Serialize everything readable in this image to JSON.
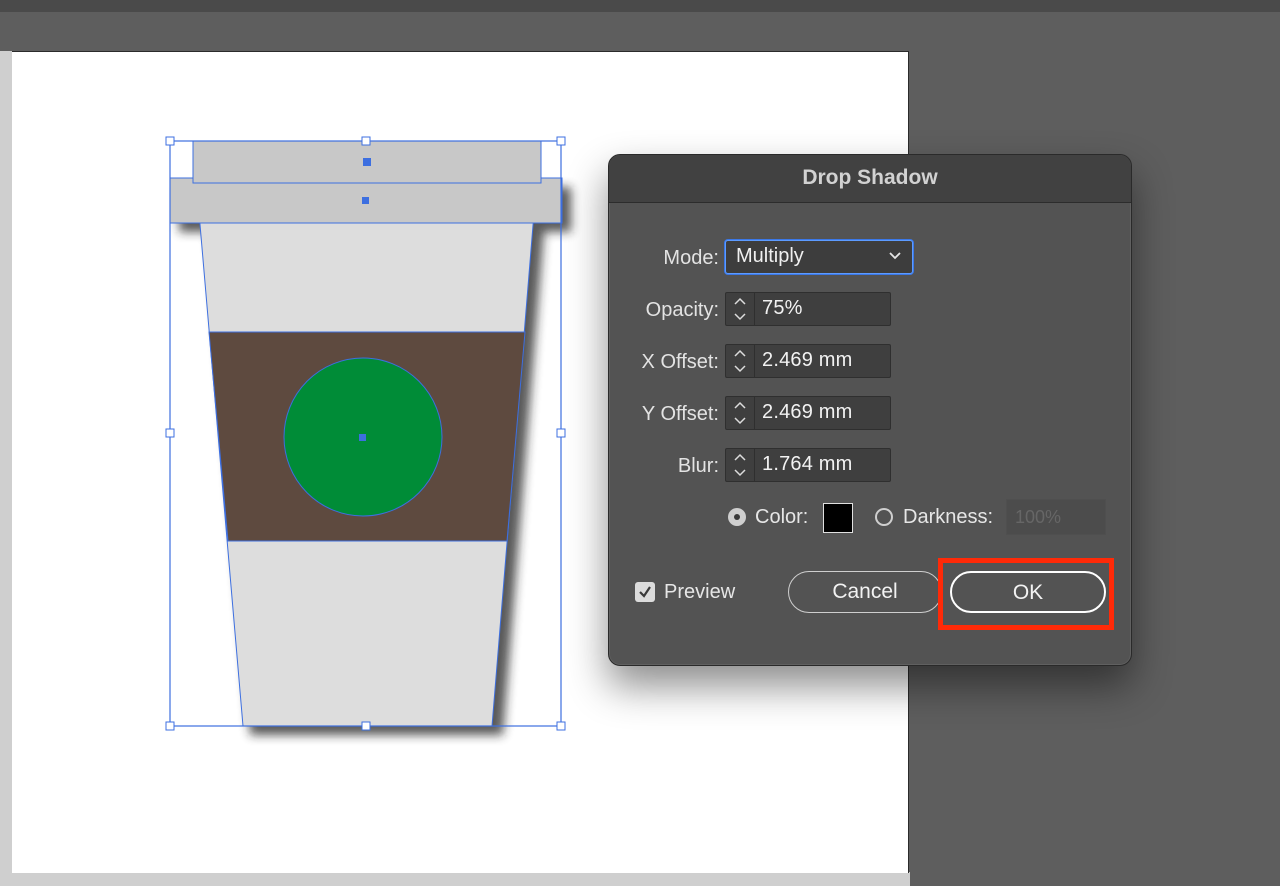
{
  "dialog": {
    "title": "Drop Shadow",
    "mode": {
      "label": "Mode:",
      "value": "Multiply"
    },
    "opacity": {
      "label": "Opacity:",
      "value": "75%"
    },
    "x_offset": {
      "label": "X Offset:",
      "value": "2.469 mm"
    },
    "y_offset": {
      "label": "Y Offset:",
      "value": "2.469 mm"
    },
    "blur": {
      "label": "Blur:",
      "value": "1.764 mm"
    },
    "color_option": {
      "label": "Color:",
      "selected": true,
      "swatch": "#000000"
    },
    "darkness_option": {
      "label": "Darkness:",
      "selected": false,
      "value": "100%"
    },
    "preview": {
      "label": "Preview",
      "checked": true
    },
    "cancel_label": "Cancel",
    "ok_label": "OK"
  },
  "colors": {
    "lid": "#c8c8c8",
    "cup": "#dddddd",
    "sleeve": "#5e4a3f",
    "logo": "#008c37",
    "selection": "#3d6fe0",
    "highlight": "#ff2a08"
  }
}
